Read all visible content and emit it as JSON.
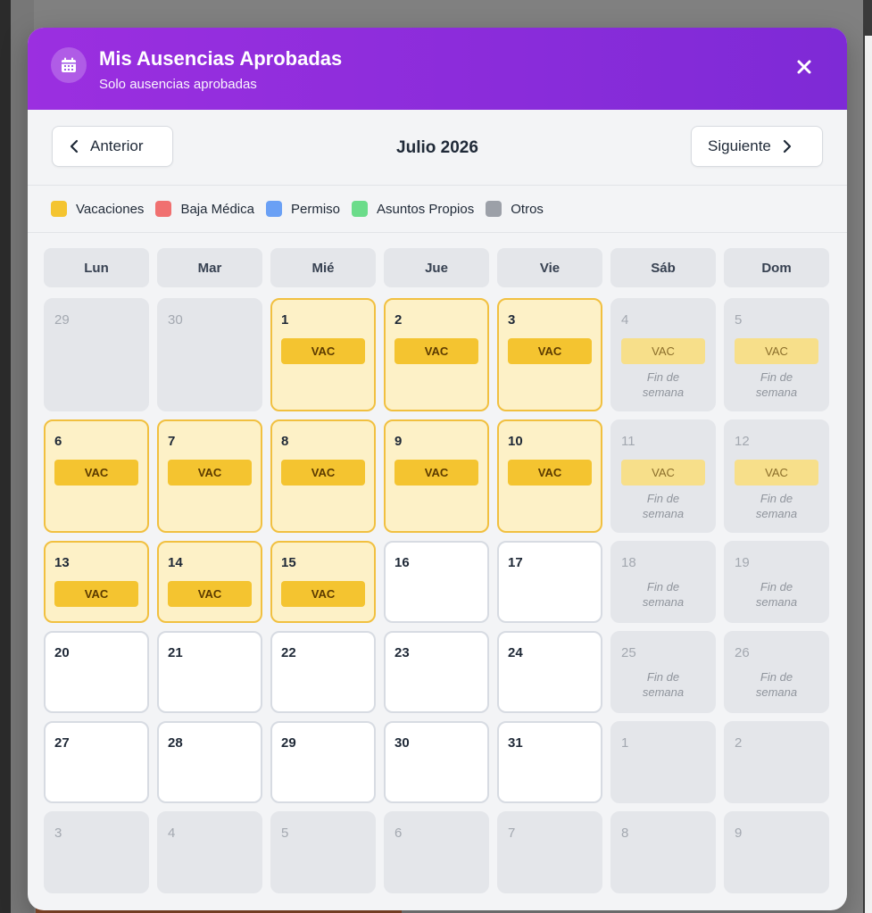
{
  "modal": {
    "title": "Mis Ausencias Aprobadas",
    "subtitle": "Solo ausencias aprobadas",
    "close_icon": "close-icon",
    "header_icon": "calendar-icon",
    "header_color": "#8a2be2"
  },
  "nav": {
    "prev_label": "Anterior",
    "next_label": "Siguiente",
    "month_title": "Julio 2026"
  },
  "legend": [
    {
      "label": "Vacaciones",
      "color": "#f4c430"
    },
    {
      "label": "Baja Médica",
      "color": "#f07070"
    },
    {
      "label": "Permiso",
      "color": "#6aa0f5"
    },
    {
      "label": "Asuntos Propios",
      "color": "#6bdc8a"
    },
    {
      "label": "Otros",
      "color": "#9ca0a8"
    }
  ],
  "weekdays": [
    "Lun",
    "Mar",
    "Mié",
    "Jue",
    "Vie",
    "Sáb",
    "Dom"
  ],
  "badge_label": "VAC",
  "weekend_label": "Fin de semana",
  "days": [
    {
      "num": "29",
      "type": "gray"
    },
    {
      "num": "30",
      "type": "gray"
    },
    {
      "num": "1",
      "type": "vac",
      "badge": true
    },
    {
      "num": "2",
      "type": "vac",
      "badge": true
    },
    {
      "num": "3",
      "type": "vac",
      "badge": true
    },
    {
      "num": "4",
      "type": "gray",
      "badge": true,
      "faded": true,
      "weekend": true
    },
    {
      "num": "5",
      "type": "gray",
      "badge": true,
      "faded": true,
      "weekend": true
    },
    {
      "num": "6",
      "type": "vac",
      "badge": true
    },
    {
      "num": "7",
      "type": "vac",
      "badge": true
    },
    {
      "num": "8",
      "type": "vac",
      "badge": true
    },
    {
      "num": "9",
      "type": "vac",
      "badge": true
    },
    {
      "num": "10",
      "type": "vac",
      "badge": true
    },
    {
      "num": "11",
      "type": "gray",
      "badge": true,
      "faded": true,
      "weekend": true
    },
    {
      "num": "12",
      "type": "gray",
      "badge": true,
      "faded": true,
      "weekend": true
    },
    {
      "num": "13",
      "type": "vac",
      "badge": true
    },
    {
      "num": "14",
      "type": "vac",
      "badge": true
    },
    {
      "num": "15",
      "type": "vac",
      "badge": true
    },
    {
      "num": "16",
      "type": "white"
    },
    {
      "num": "17",
      "type": "white"
    },
    {
      "num": "18",
      "type": "gray",
      "weekend": true
    },
    {
      "num": "19",
      "type": "gray",
      "weekend": true
    },
    {
      "num": "20",
      "type": "white"
    },
    {
      "num": "21",
      "type": "white"
    },
    {
      "num": "22",
      "type": "white"
    },
    {
      "num": "23",
      "type": "white"
    },
    {
      "num": "24",
      "type": "white"
    },
    {
      "num": "25",
      "type": "gray",
      "weekend": true
    },
    {
      "num": "26",
      "type": "gray",
      "weekend": true
    },
    {
      "num": "27",
      "type": "white"
    },
    {
      "num": "28",
      "type": "white"
    },
    {
      "num": "29",
      "type": "white"
    },
    {
      "num": "30",
      "type": "white"
    },
    {
      "num": "31",
      "type": "white"
    },
    {
      "num": "1",
      "type": "gray"
    },
    {
      "num": "2",
      "type": "gray"
    },
    {
      "num": "3",
      "type": "gray"
    },
    {
      "num": "4",
      "type": "gray"
    },
    {
      "num": "5",
      "type": "gray"
    },
    {
      "num": "6",
      "type": "gray"
    },
    {
      "num": "7",
      "type": "gray"
    },
    {
      "num": "8",
      "type": "gray"
    },
    {
      "num": "9",
      "type": "gray"
    }
  ]
}
